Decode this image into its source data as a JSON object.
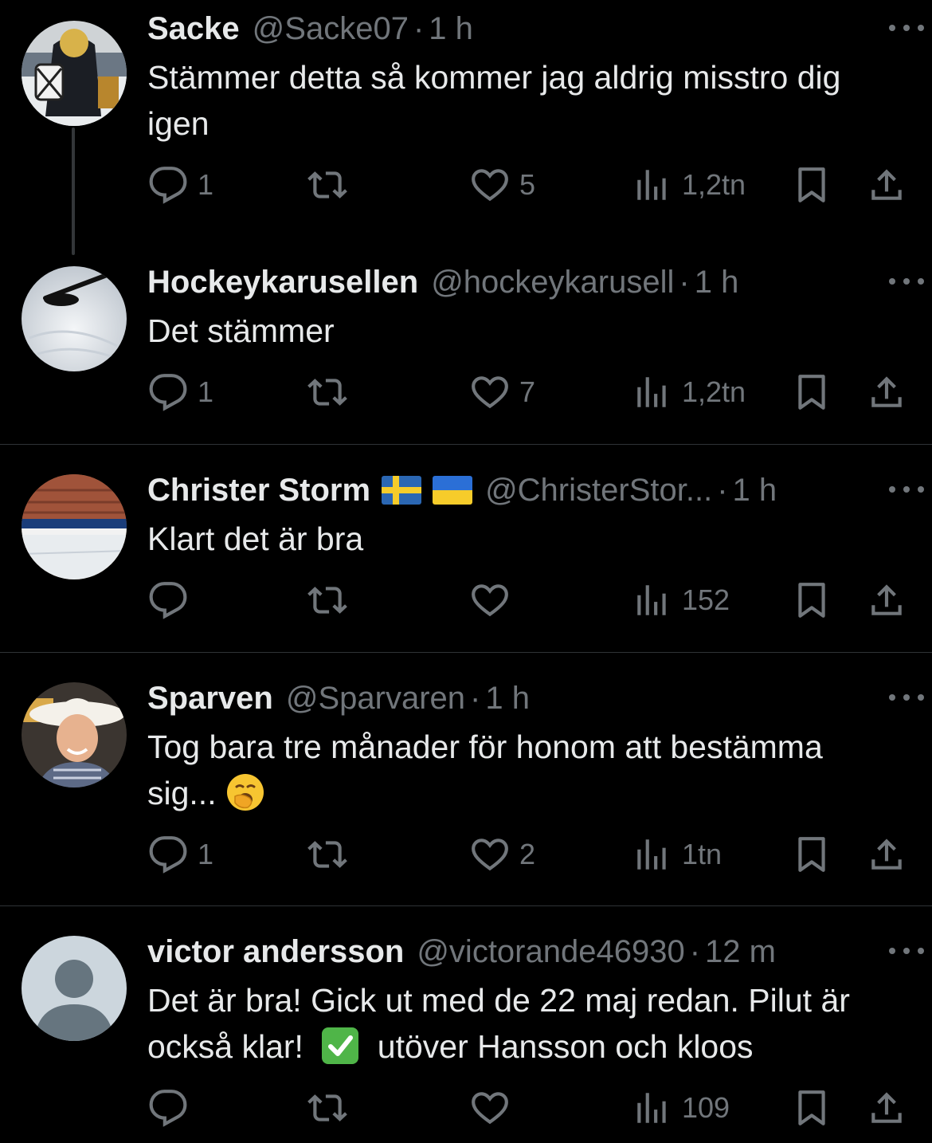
{
  "tweets": [
    {
      "name": "Sacke",
      "handle": "@Sacke07",
      "time": "1 h",
      "text_lines": [
        "Stämmer detta så kommer jag aldrig misstro dig",
        "igen"
      ],
      "replies": "1",
      "likes": "5",
      "views": "1,2tn"
    },
    {
      "name": "Hockeykarusellen",
      "handle": "@hockeykarusell",
      "time": "1 h",
      "text_lines": [
        "Det stämmer"
      ],
      "replies": "1",
      "likes": "7",
      "views": "1,2tn"
    },
    {
      "name": "Christer Storm",
      "flags": [
        "sweden-flag",
        "ukraine-flag"
      ],
      "handle": "@ChristerStor...",
      "time": "1 h",
      "text_lines": [
        "Klart det är bra"
      ],
      "replies": "",
      "likes": "",
      "views": "152"
    },
    {
      "name": "Sparven",
      "handle": "@Sparvaren",
      "time": "1 h",
      "text_lines": [
        "Tog bara tre månader för honom att bestämma",
        "sig..."
      ],
      "text_emoji": "yawning-face-emoji",
      "replies": "1",
      "likes": "2",
      "views": "1tn"
    },
    {
      "name": "victor andersson",
      "handle": "@victorande46930",
      "time": "12 m",
      "text_lines": [
        "Det är bra! Gick ut med de 22 maj redan. Pilut är",
        "också klar!",
        "utöver Hansson och kloos"
      ],
      "text_emoji": "check-mark-emoji",
      "replies": "",
      "likes": "",
      "views": "109"
    }
  ],
  "separator": "·",
  "colors": {
    "background": "#000000",
    "text": "#e7e9ea",
    "muted": "#71767b",
    "divider": "#2f3336"
  }
}
